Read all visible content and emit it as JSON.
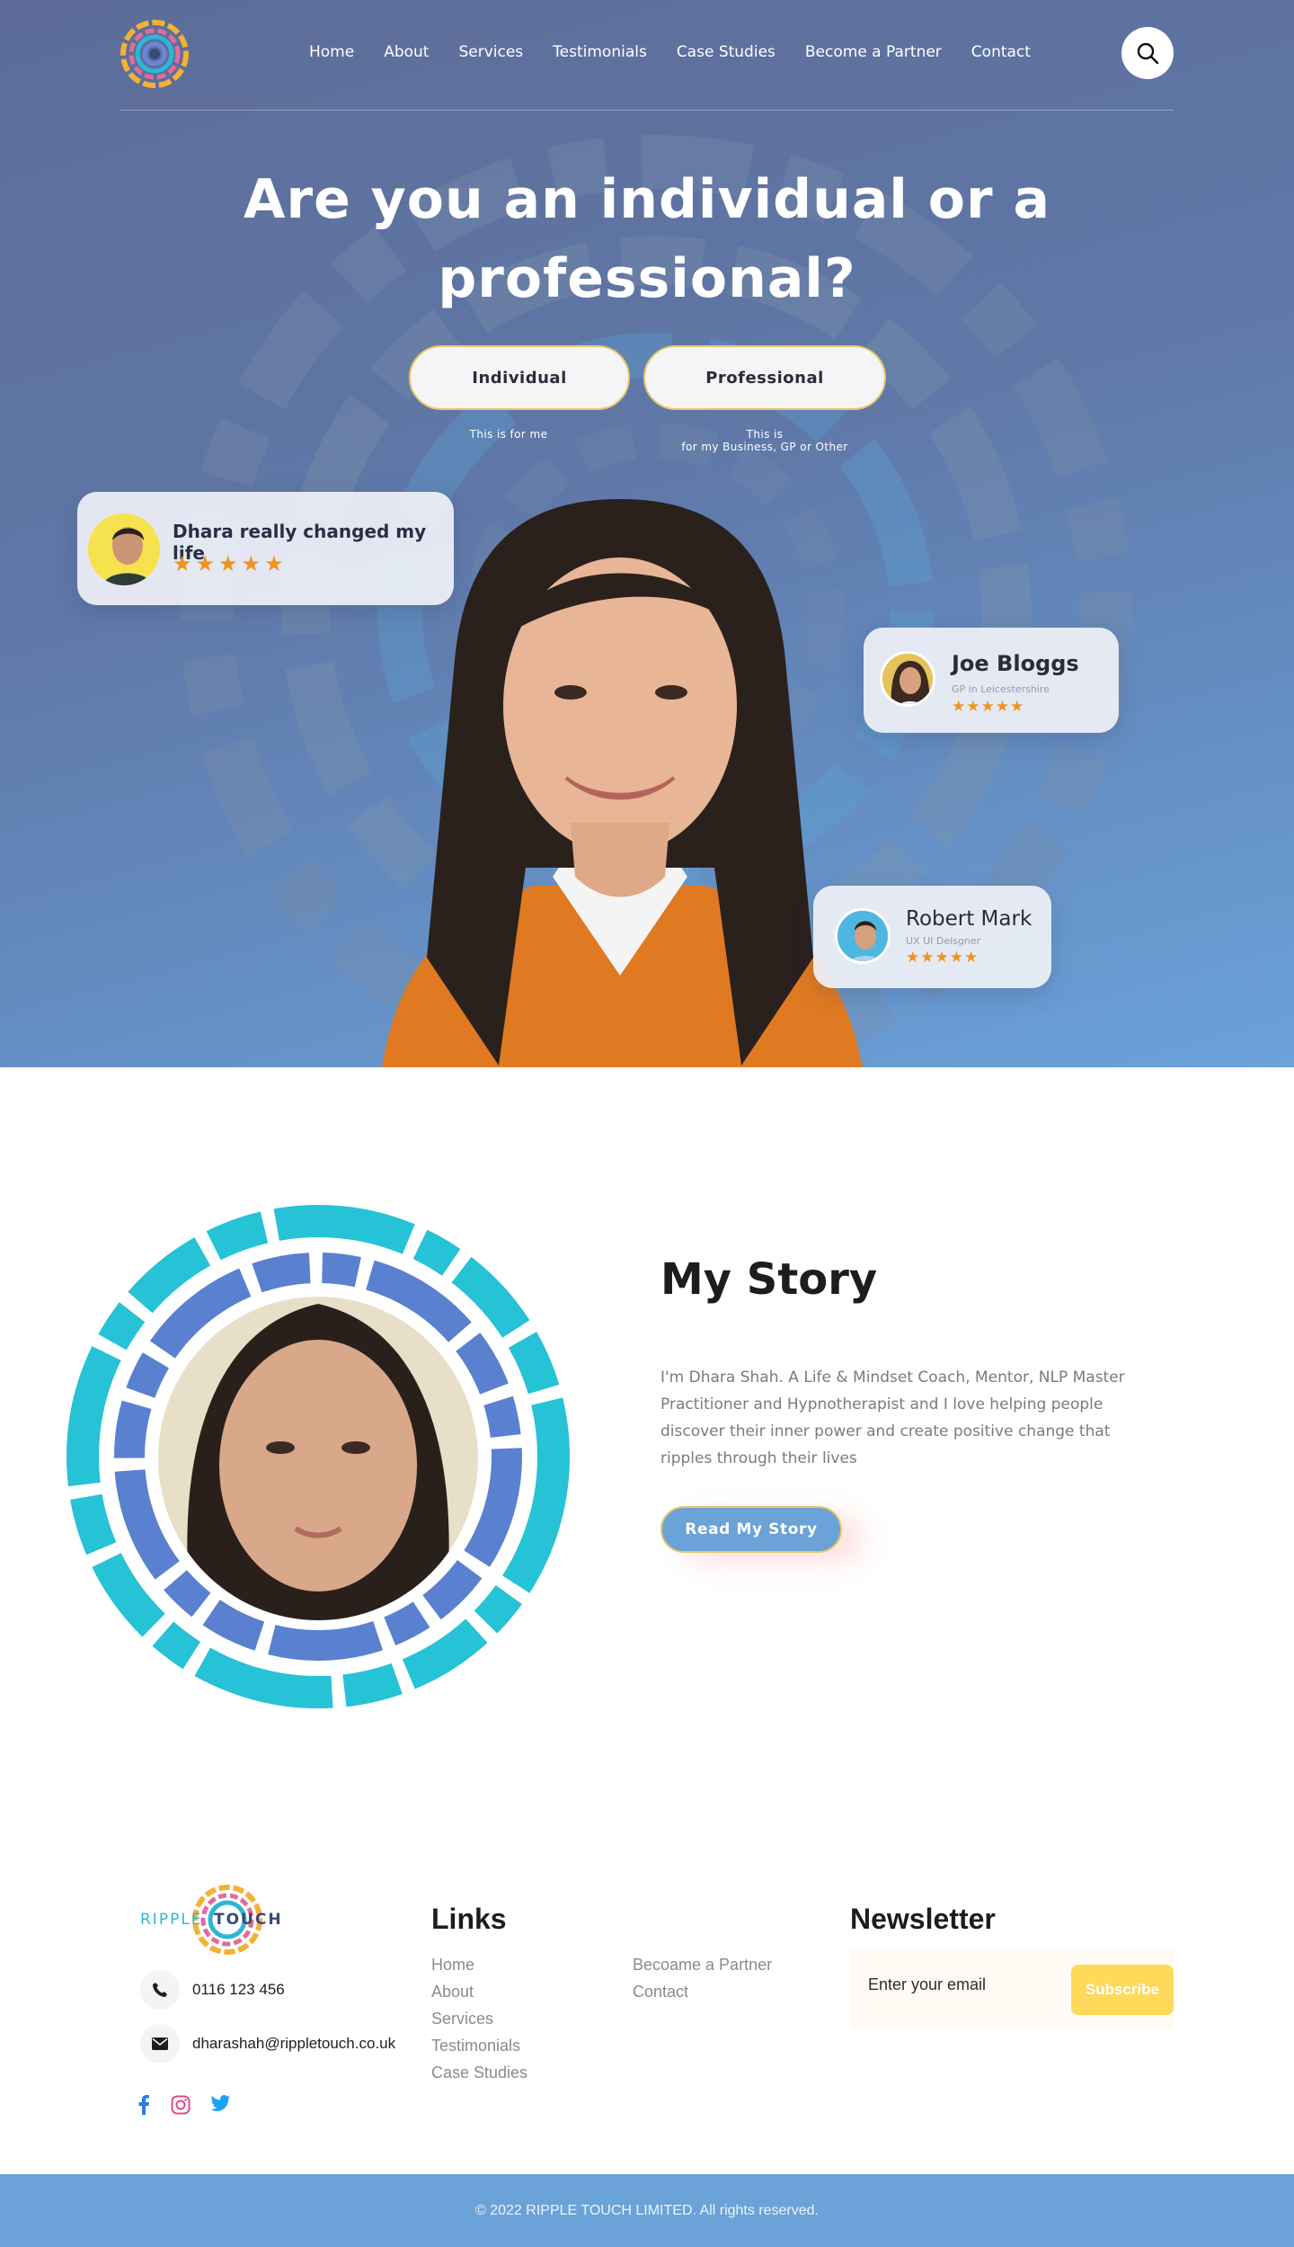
{
  "colors": {
    "accent_blue": "#6ba2d8",
    "hero_top": "#5d6c98",
    "gold": "#e8c66a",
    "star_orange": "#f0921f",
    "ring_teal": "#26c2d6",
    "ring_blue": "#5a80d0",
    "subscribe_yellow": "#ffd95a"
  },
  "nav": {
    "items": [
      "Home",
      "About",
      "Services",
      "Testimonials",
      "Case Studies",
      "Become a Partner",
      "Contact"
    ],
    "search_icon": "search-icon"
  },
  "hero": {
    "title_line1": "Are you an individual or a",
    "title_line2": "professional?",
    "individual_label": "Individual",
    "individual_sub": "This is for me",
    "professional_label": "Professional",
    "professional_sub_line1": "This is",
    "professional_sub_line2": "for my Business, GP or Other"
  },
  "reviews": [
    {
      "quote": "Dhara really changed my life",
      "stars": "★★★★★"
    },
    {
      "name": "Joe Bloggs",
      "role": "GP in Leicestershire",
      "stars": "★★★★★"
    },
    {
      "name": "Robert Mark",
      "role": "UX UI Deisgner",
      "stars": "★★★★★"
    }
  ],
  "story": {
    "title": "My Story",
    "text": "I'm Dhara Shah. A Life & Mindset Coach, Mentor, NLP Master Practitioner and Hypnotherapist and I love helping people discover their inner power and create positive change that ripples through their lives",
    "button": "Read My Story"
  },
  "footer": {
    "logo_text_1": "RIPPLE",
    "logo_text_2": "TOUCH",
    "phone": "0116 123 456",
    "email": "dharashah@rippletouch.co.uk",
    "links_title": "Links",
    "links_col1": [
      "Home",
      "About",
      "Services",
      "Testimonials",
      "Case Studies"
    ],
    "links_col2": [
      "Becoame a Partner",
      "Contact"
    ],
    "newsletter_title": "Newsletter",
    "newsletter_placeholder": "Enter your email",
    "subscribe": "Subscribe",
    "copyright": "© 2022 RIPPLE TOUCH LIMITED. All rights reserved."
  }
}
